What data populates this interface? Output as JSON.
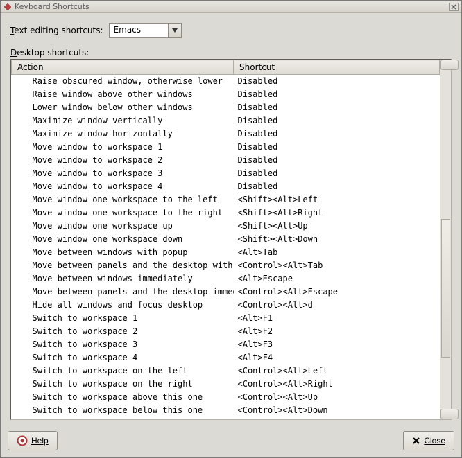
{
  "window": {
    "title": "Keyboard Shortcuts"
  },
  "editing": {
    "label": "Text editing shortcuts:",
    "selected": "Emacs"
  },
  "desktop_label": "Desktop shortcuts:",
  "columns": {
    "action": "Action",
    "shortcut": "Shortcut"
  },
  "rows": [
    {
      "action": "Raise obscured window, otherwise lower",
      "shortcut": "Disabled"
    },
    {
      "action": "Raise window above other windows",
      "shortcut": "Disabled"
    },
    {
      "action": "Lower window below other windows",
      "shortcut": "Disabled"
    },
    {
      "action": "Maximize window vertically",
      "shortcut": "Disabled"
    },
    {
      "action": "Maximize window horizontally",
      "shortcut": "Disabled"
    },
    {
      "action": "Move window to workspace 1",
      "shortcut": "Disabled"
    },
    {
      "action": "Move window to workspace 2",
      "shortcut": "Disabled"
    },
    {
      "action": "Move window to workspace 3",
      "shortcut": "Disabled"
    },
    {
      "action": "Move window to workspace 4",
      "shortcut": "Disabled"
    },
    {
      "action": "Move window one workspace to the left",
      "shortcut": "<Shift><Alt>Left"
    },
    {
      "action": "Move window one workspace to the right",
      "shortcut": "<Shift><Alt>Right"
    },
    {
      "action": "Move window one workspace up",
      "shortcut": "<Shift><Alt>Up"
    },
    {
      "action": "Move window one workspace down",
      "shortcut": "<Shift><Alt>Down"
    },
    {
      "action": "Move between windows with popup",
      "shortcut": "<Alt>Tab"
    },
    {
      "action": "Move between panels and the desktop with popup",
      "shortcut": "<Control><Alt>Tab"
    },
    {
      "action": "Move between windows immediately",
      "shortcut": "<Alt>Escape"
    },
    {
      "action": "Move between panels and the desktop immediately",
      "shortcut": "<Control><Alt>Escape"
    },
    {
      "action": "Hide all windows and focus desktop",
      "shortcut": "<Control><Alt>d"
    },
    {
      "action": "Switch to workspace 1",
      "shortcut": "<Alt>F1"
    },
    {
      "action": "Switch to workspace 2",
      "shortcut": "<Alt>F2"
    },
    {
      "action": "Switch to workspace 3",
      "shortcut": "<Alt>F3"
    },
    {
      "action": "Switch to workspace 4",
      "shortcut": "<Alt>F4"
    },
    {
      "action": "Switch to workspace on the left",
      "shortcut": "<Control><Alt>Left"
    },
    {
      "action": "Switch to workspace on the right",
      "shortcut": "<Control><Alt>Right"
    },
    {
      "action": "Switch to workspace above this one",
      "shortcut": "<Control><Alt>Up"
    },
    {
      "action": "Switch to workspace below this one",
      "shortcut": "<Control><Alt>Down"
    }
  ],
  "footer": {
    "help": "Help",
    "close": "Close"
  }
}
